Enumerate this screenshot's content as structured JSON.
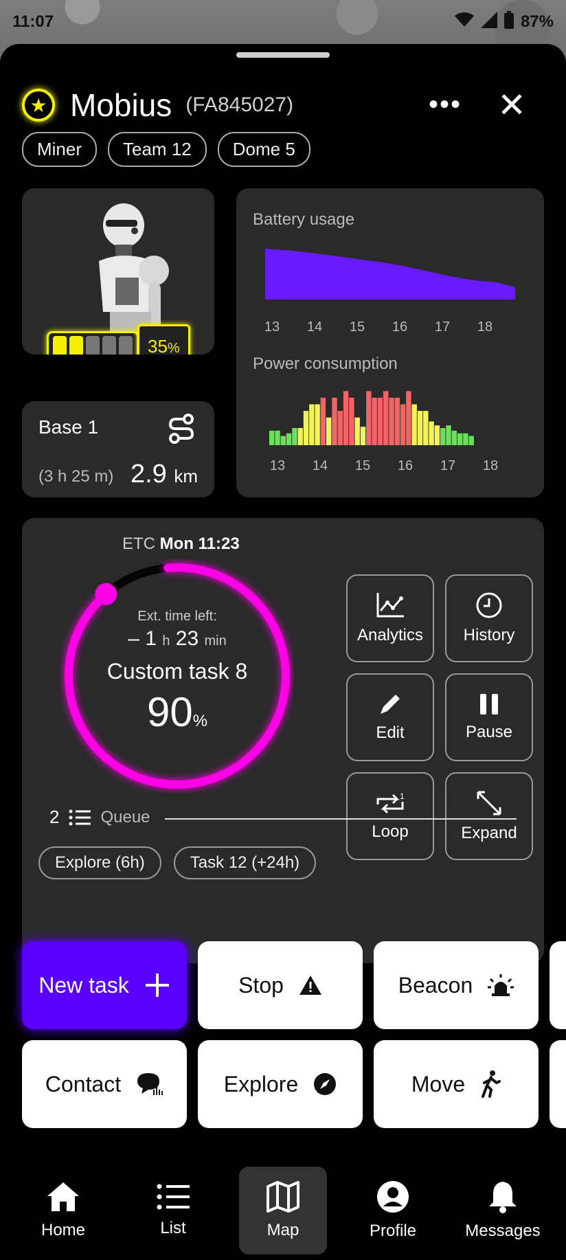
{
  "status": {
    "time": "11:07",
    "battery": "87%"
  },
  "robot": {
    "name": "Mobius",
    "id": "(FA845027)",
    "tags": [
      "Miner",
      "Team 12",
      "Dome 5"
    ],
    "battery_pct": "35",
    "battery_unit": "%",
    "battery_level": 0.35
  },
  "route": {
    "destination": "Base 1",
    "duration": "(3 h 25 m)",
    "distance": "2.9",
    "distance_unit": "km"
  },
  "battery_chart": {
    "title": "Battery usage",
    "ticks": [
      "13",
      "14",
      "15",
      "16",
      "17",
      "18"
    ]
  },
  "power_chart": {
    "title": "Power consumption",
    "ticks": [
      "13",
      "14",
      "15",
      "16",
      "17",
      "18"
    ]
  },
  "chart_data": [
    {
      "type": "area",
      "title": "Battery usage",
      "x": [
        13,
        13.5,
        14,
        14.5,
        15,
        15.5,
        16,
        16.5,
        17,
        17.5,
        18,
        18.4
      ],
      "values": [
        100,
        97,
        92,
        86,
        80,
        74,
        66,
        56,
        46,
        38,
        34,
        24
      ],
      "color": "#6a1aff"
    },
    {
      "type": "bar",
      "title": "Power consumption",
      "categories": [
        "13",
        "",
        "",
        "",
        "",
        "",
        "",
        "",
        "",
        "14",
        "",
        "",
        "",
        "",
        "",
        "",
        "",
        "",
        "15",
        "",
        "",
        "",
        "",
        "",
        "",
        "",
        "",
        "16",
        "",
        "",
        "",
        "",
        "",
        "",
        "",
        "",
        "17",
        "",
        "",
        "",
        "",
        "",
        "",
        "",
        "",
        "18",
        "",
        "",
        ""
      ],
      "values": [
        22,
        22,
        14,
        18,
        26,
        26,
        52,
        62,
        62,
        72,
        42,
        72,
        52,
        82,
        72,
        42,
        28,
        82,
        72,
        72,
        82,
        72,
        72,
        62,
        82,
        62,
        52,
        52,
        36,
        30,
        26,
        30,
        22,
        18,
        18,
        14
      ],
      "colors": [
        "#6be05a",
        "#6be05a",
        "#6be05a",
        "#6be05a",
        "#6be05a",
        "#f4f25a",
        "#f4f25a",
        "#f4f25a",
        "#f4f25a",
        "#f46464",
        "#f4f25a",
        "#f46464",
        "#f46464",
        "#f46464",
        "#f46464",
        "#f4f25a",
        "#f4f25a",
        "#f46464",
        "#f46464",
        "#f46464",
        "#f46464",
        "#f46464",
        "#f46464",
        "#f46464",
        "#f46464",
        "#f4f25a",
        "#f4f25a",
        "#f4f25a",
        "#f4f25a",
        "#f4f25a",
        "#6be05a",
        "#6be05a",
        "#6be05a",
        "#6be05a",
        "#6be05a",
        "#6be05a"
      ]
    }
  ],
  "task": {
    "etc_label": "ETC",
    "etc_value": "Mon 11:23",
    "time_left_label": "Ext. time left:",
    "time_left_prefix": "– 1",
    "time_left_h": "h",
    "time_left_min_val": "23",
    "time_left_min": "min",
    "name": "Custom task 8",
    "progress": "90",
    "progress_unit": "%",
    "progress_fraction": 0.9
  },
  "actions": [
    {
      "label": "Analytics",
      "icon": "analytics-icon"
    },
    {
      "label": "History",
      "icon": "clock-icon"
    },
    {
      "label": "Edit",
      "icon": "pencil-icon"
    },
    {
      "label": "Pause",
      "icon": "pause-icon"
    },
    {
      "label": "Loop",
      "icon": "repeat-one-icon"
    },
    {
      "label": "Expand",
      "icon": "expand-icon"
    }
  ],
  "queue": {
    "count": "2",
    "label": "Queue",
    "items": [
      "Explore (6h)",
      "Task 12 (+24h)"
    ]
  },
  "commands": [
    {
      "label": "New task",
      "icon": "plus-icon"
    },
    {
      "label": "Stop",
      "icon": "warning-icon"
    },
    {
      "label": "Beacon",
      "icon": "siren-icon"
    },
    {
      "label": "Contact",
      "icon": "chat-icon"
    },
    {
      "label": "Explore",
      "icon": "compass-icon"
    },
    {
      "label": "Move",
      "icon": "walk-icon"
    }
  ],
  "nav": [
    {
      "label": "Home",
      "icon": "home-icon"
    },
    {
      "label": "List",
      "icon": "list-icon"
    },
    {
      "label": "Map",
      "icon": "map-icon",
      "active": true
    },
    {
      "label": "Profile",
      "icon": "profile-icon"
    },
    {
      "label": "Messages",
      "icon": "bell-icon"
    }
  ],
  "colors": {
    "accent_magenta": "#ff00e6",
    "accent_purple": "#5a00ff",
    "accent_yellow": "#f5f000"
  }
}
